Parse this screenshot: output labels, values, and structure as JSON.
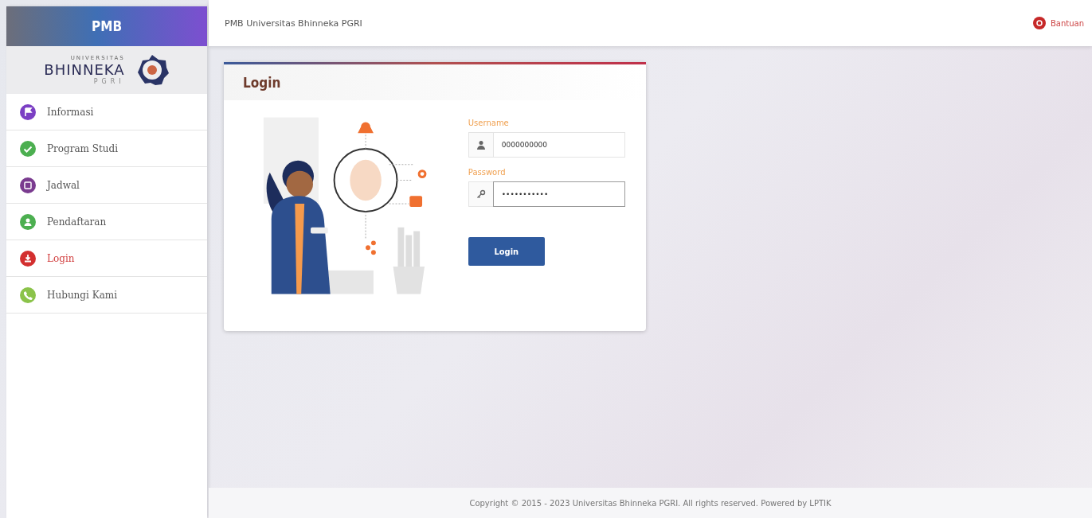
{
  "brand": "PMB",
  "logo": {
    "small": "UNIVERSITAS",
    "name": "BHINNEKA",
    "sub": "PGRI"
  },
  "sidebar": {
    "items": [
      {
        "label": "Informasi",
        "selected": false,
        "color": "#7b3fc4",
        "kind": "flag"
      },
      {
        "label": "Program Studi",
        "selected": false,
        "color": "#4caf50",
        "kind": "check"
      },
      {
        "label": "Jadwal",
        "selected": false,
        "color": "#7a3b8f",
        "kind": "calendar"
      },
      {
        "label": "Pendaftaran",
        "selected": false,
        "color": "#4caf50",
        "kind": "user"
      },
      {
        "label": "Login",
        "selected": true,
        "color": "#d32f2f",
        "kind": "download"
      },
      {
        "label": "Hubungi Kami",
        "selected": false,
        "color": "#8bc34a",
        "kind": "phone"
      }
    ]
  },
  "topbar": {
    "title": "PMB Universitas Bhinneka PGRI",
    "help": "Bantuan"
  },
  "login": {
    "title": "Login",
    "fields": [
      {
        "label": "Username",
        "value": "0000000000",
        "kind": "user",
        "focused": false
      },
      {
        "label": "Password",
        "value": "•••••••••••",
        "kind": "key",
        "focused": true
      }
    ],
    "button": "Login"
  },
  "footer": "Copyright © 2015 - 2023 Universitas Bhinneka PGRI. All rights reserved. Powered by LPTIK"
}
